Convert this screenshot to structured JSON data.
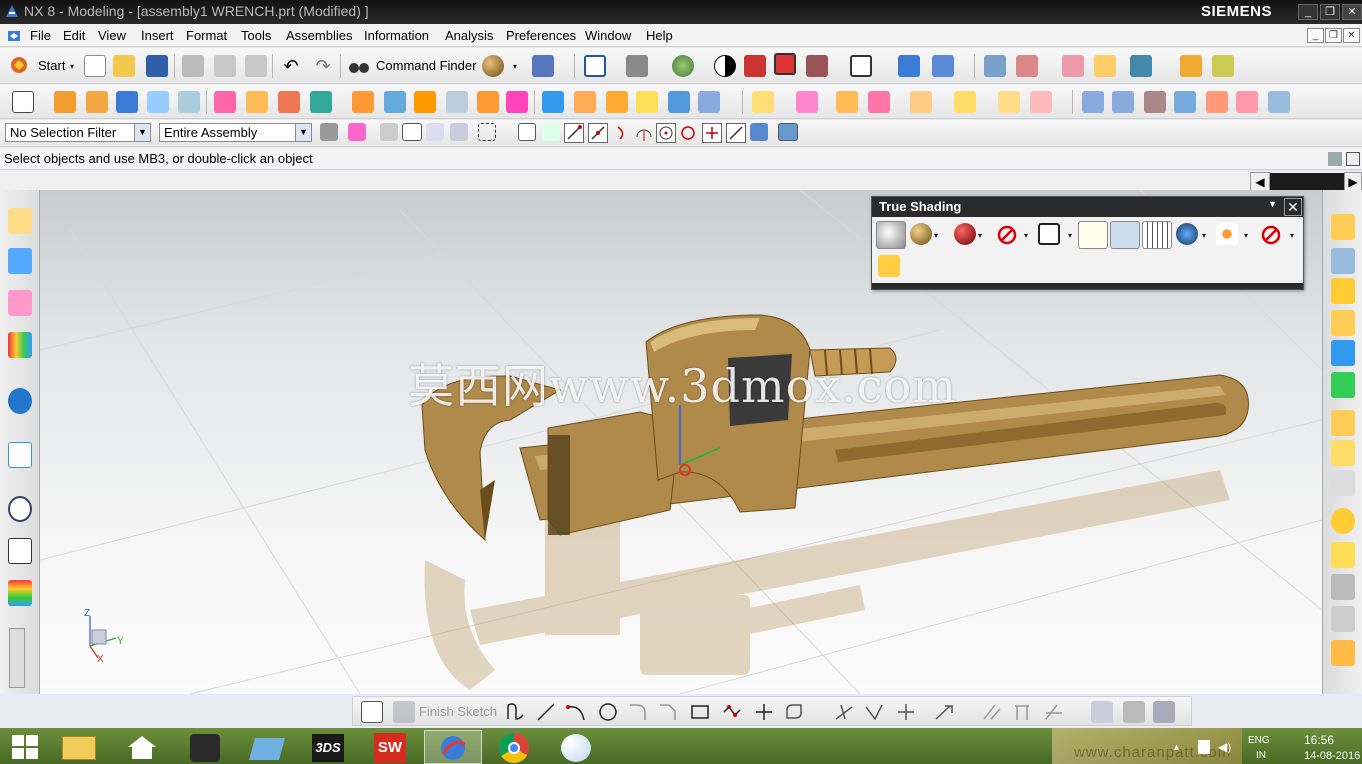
{
  "window": {
    "title": "NX 8 - Modeling - [assembly1 WRENCH.prt (Modified) ]",
    "brand": "SIEMENS",
    "minimize_label": "_",
    "restore_label": "❐",
    "close_label": "✕"
  },
  "menu": [
    "File",
    "Edit",
    "View",
    "Insert",
    "Format",
    "Tools",
    "Assemblies",
    "Information",
    "Analysis",
    "Preferences",
    "Window",
    "Help"
  ],
  "standard_toolbar": {
    "start_label": "Start",
    "command_finder_label": "Command Finder"
  },
  "selection_bar": {
    "filter_value": "No Selection Filter",
    "scope_value": "Entire Assembly"
  },
  "status": {
    "prompt": "Select objects and use MB3, or double-click an object"
  },
  "true_shading": {
    "title": "True Shading"
  },
  "viewport": {
    "watermark": "莫西网www.3dmox.com",
    "triad": {
      "z": "Z",
      "y": "Y",
      "x": "X"
    },
    "model_color": "#b08a4a"
  },
  "sketch_toolbar": {
    "finish_label": "Finish Sketch"
  },
  "taskbar": {
    "time": "16:56",
    "date": "14-08-2016",
    "lang": "ENG",
    "region": "IN",
    "tray_text": "www.charanpatt.com",
    "items": [
      "windows-start",
      "file-explorer",
      "home",
      "app-shadow",
      "app-folder",
      "solidworks-3ds",
      "solidworks",
      "nx-active",
      "chrome",
      "paint"
    ]
  }
}
